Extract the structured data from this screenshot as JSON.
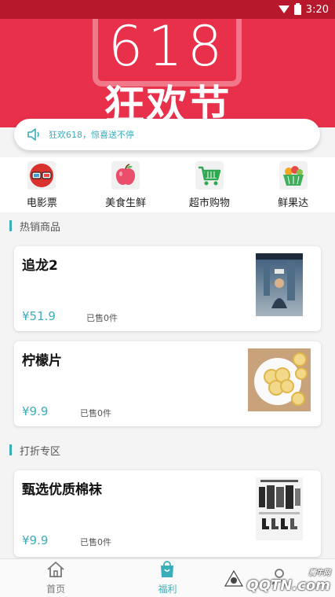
{
  "status_bar": {
    "time": "3:20"
  },
  "banner": {
    "big_text": "618",
    "title": "狂欢节"
  },
  "notice": {
    "text": "狂欢618，惊喜送不停"
  },
  "categories": [
    {
      "label": "电影票",
      "icon": "3d-glasses-icon"
    },
    {
      "label": "美食生鲜",
      "icon": "apple-icon"
    },
    {
      "label": "超市购物",
      "icon": "shopping-cart-icon"
    },
    {
      "label": "鲜果达",
      "icon": "fruit-basket-icon"
    }
  ],
  "sections": {
    "hot": "热销商品",
    "discount": "打折专区"
  },
  "products": [
    {
      "name": "追龙2",
      "price": "¥51.9",
      "sold": "已售0件"
    },
    {
      "name": "柠檬片",
      "price": "¥9.9",
      "sold": "已售0件"
    },
    {
      "name": "甄选优质棉袜",
      "price": "¥9.9",
      "sold": "已售0件"
    }
  ],
  "bottom_nav": [
    {
      "label": "首页",
      "icon": "home-icon"
    },
    {
      "label": "福利",
      "icon": "shopping-bag-icon"
    },
    {
      "label": "",
      "icon": "user-icon"
    }
  ],
  "watermark": {
    "text": "QQTN.com",
    "sub": "腾牛网"
  },
  "colors": {
    "accent": "#3aaebb",
    "banner": "#e9304b"
  }
}
